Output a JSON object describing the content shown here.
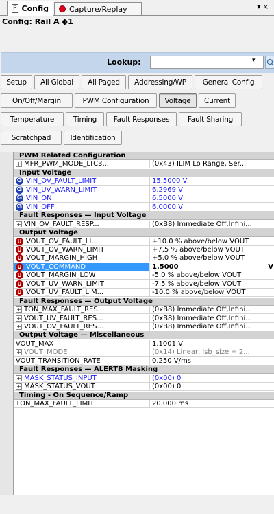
{
  "tabs": [
    {
      "icon": "P",
      "label": "Config"
    },
    {
      "label": "Capture/Replay"
    }
  ],
  "tab_menu": "▾ ×",
  "config_title": "Config: Rail A ɸ1",
  "lookup": {
    "label": "Lookup:",
    "value": "",
    "drop": "▾",
    "search_icon": "🔍"
  },
  "toolbar": {
    "row1": [
      "Setup",
      "All Global",
      "All Paged",
      "Addressing/WP",
      "General Config"
    ],
    "row2": [
      "On/Off/Margin",
      "PWM Configuration",
      "Voltage",
      "Current"
    ],
    "row3": [
      "Temperature",
      "Timing",
      "Fault Responses",
      "Fault Sharing"
    ],
    "row4": [
      "Scratchpad",
      "Identification"
    ]
  },
  "grid": {
    "rows": [
      {
        "type": "cat",
        "name": "PWM Related Configuration"
      },
      {
        "type": "plus",
        "name": "MFR_PWM_MODE_LTC3...",
        "value": "(0x43) ILIM Lo Range, Ser..."
      },
      {
        "type": "cat",
        "name": "Input Voltage"
      },
      {
        "type": "g",
        "name": "VIN_OV_FAULT_LIMIT",
        "value": "15.5000 V",
        "color": "blue"
      },
      {
        "type": "g",
        "name": "VIN_UV_WARN_LIMIT",
        "value": "6.2969 V",
        "color": "blue"
      },
      {
        "type": "g",
        "name": "VIN_ON",
        "value": "6.5000 V",
        "color": "blue"
      },
      {
        "type": "g",
        "name": "VIN_OFF",
        "value": "6.0000 V",
        "color": "blue"
      },
      {
        "type": "cat",
        "name": "Fault Responses — Input Voltage"
      },
      {
        "type": "plus",
        "name": "VIN_OV_FAULT_RESP...",
        "value": "(0xB8) Immediate Off,Infini..."
      },
      {
        "type": "cat",
        "name": "Output Voltage"
      },
      {
        "type": "u",
        "name": "VOUT_OV_FAULT_LI...",
        "value": "+10.0 % above/below VOUT"
      },
      {
        "type": "u",
        "name": "VOUT_OV_WARN_LIMIT",
        "value": "+7.5 % above/below VOUT"
      },
      {
        "type": "u",
        "name": "VOUT_MARGIN_HIGH",
        "value": "+5.0 % above/below VOUT"
      },
      {
        "type": "u",
        "name": "VOUT_COMMAND",
        "value": "1.5000",
        "selected": true,
        "unit": "V"
      },
      {
        "type": "u",
        "name": "VOUT_MARGIN_LOW",
        "value": "-5.0 % above/below VOUT"
      },
      {
        "type": "u",
        "name": "VOUT_UV_WARN_LIMIT",
        "value": "-7.5 % above/below VOUT"
      },
      {
        "type": "u",
        "name": "VOUT_UV_FAULT_LIM...",
        "value": "-10.0 % above/below VOUT"
      },
      {
        "type": "cat",
        "name": "Fault Responses — Output Voltage"
      },
      {
        "type": "plus",
        "name": "TON_MAX_FAULT_RES...",
        "value": "(0xB8) Immediate Off,Infini..."
      },
      {
        "type": "plus",
        "name": "VOUT_UV_FAULT_RES...",
        "value": "(0xB8) Immediate Off,Infini..."
      },
      {
        "type": "plus",
        "name": "VOUT_OV_FAULT_RES...",
        "value": "(0xB8) Immediate Off,Infini..."
      },
      {
        "type": "cat",
        "name": "Output Voltage — Miscellaneous"
      },
      {
        "type": "plain",
        "name": "VOUT_MAX",
        "value": "1.1001 V"
      },
      {
        "type": "plus",
        "name": "VOUT_MODE",
        "value": "(0x14) Linear, lsb_size = 2...",
        "color": "grey"
      },
      {
        "type": "plain",
        "name": "VOUT_TRANSITION_RATE",
        "value": "0.250 V/ms"
      },
      {
        "type": "cat",
        "name": "Fault Responses — ALERTB Masking"
      },
      {
        "type": "plus",
        "name": "MASK_STATUS_INPUT",
        "value": "(0x00) 0",
        "color": "blue"
      },
      {
        "type": "plus",
        "name": "MASK_STATUS_VOUT",
        "value": "(0x00) 0"
      },
      {
        "type": "cat",
        "name": "Timing - On Sequence/Ramp"
      },
      {
        "type": "plain",
        "name": "TON_MAX_FAULT_LIMIT",
        "value": "20.000 ms"
      }
    ]
  }
}
